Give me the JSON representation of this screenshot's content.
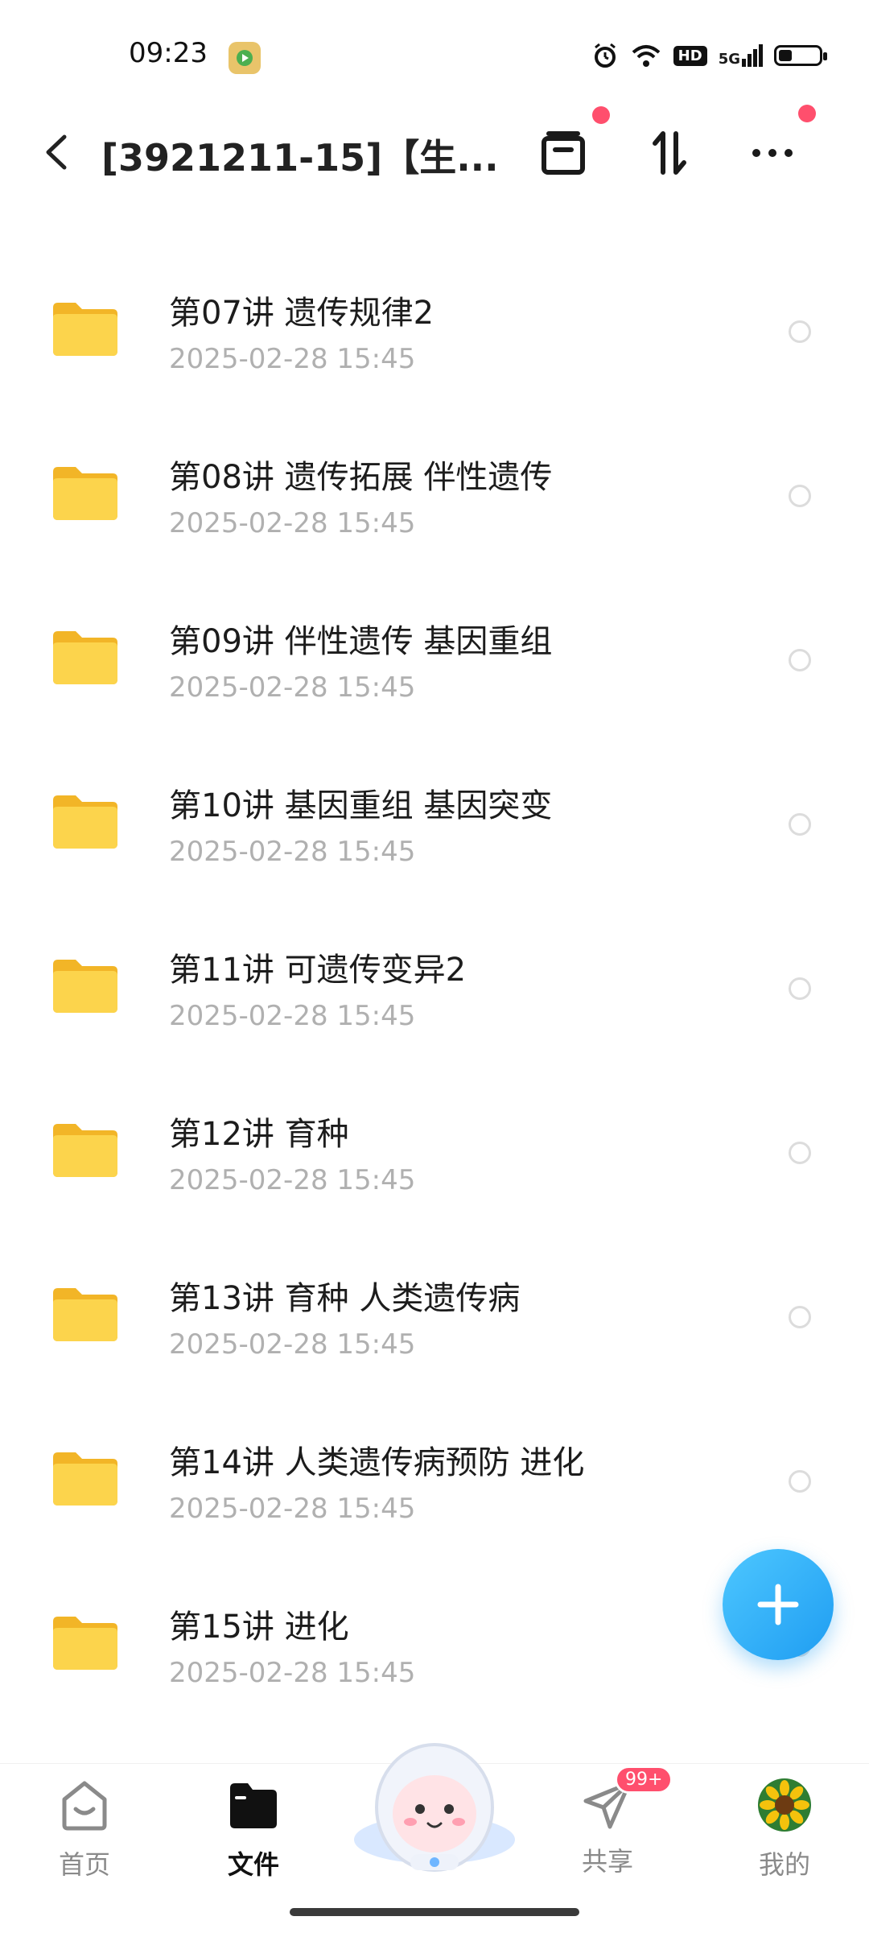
{
  "status_bar": {
    "time": "09:23",
    "hd": "HD",
    "network": "5G"
  },
  "header": {
    "title": "[3921211-15]【生..."
  },
  "colors": {
    "accent": "#1f9df2",
    "folder": "#f7c63c",
    "badge": "#ff4f6d"
  },
  "files": [
    {
      "name": "第07讲 遗传规律2",
      "date": "2025-02-28  15:45"
    },
    {
      "name": "第08讲 遗传拓展 伴性遗传",
      "date": "2025-02-28  15:45"
    },
    {
      "name": "第09讲 伴性遗传 基因重组",
      "date": "2025-02-28  15:45"
    },
    {
      "name": "第10讲 基因重组 基因突变",
      "date": "2025-02-28  15:45"
    },
    {
      "name": "第11讲 可遗传变异2",
      "date": "2025-02-28  15:45"
    },
    {
      "name": "第12讲 育种",
      "date": "2025-02-28  15:45"
    },
    {
      "name": "第13讲 育种 人类遗传病",
      "date": "2025-02-28  15:45"
    },
    {
      "name": "第14讲 人类遗传病预防 进化",
      "date": "2025-02-28  15:45"
    },
    {
      "name": "第15讲 进化",
      "date": "2025-02-28  15:45"
    }
  ],
  "nav": {
    "home": "首页",
    "files": "文件",
    "share": "共享",
    "share_badge": "99+",
    "mine": "我的"
  }
}
